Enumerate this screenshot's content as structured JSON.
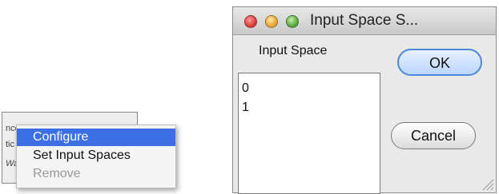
{
  "background_panel": {
    "row1_text": "nce I",
    "row2_text": "tic",
    "row3_text": "Wati"
  },
  "context_menu": {
    "items": [
      {
        "label": "Configure",
        "state": "highlighted"
      },
      {
        "label": "Set Input Spaces",
        "state": "enabled"
      },
      {
        "label": "Remove",
        "state": "disabled"
      }
    ],
    "highlight_color": "#3c6fe4"
  },
  "dialog": {
    "title": "Input Space S...",
    "list_label": "Input Space",
    "list_items": [
      "0",
      "1"
    ],
    "ok_label": "OK",
    "cancel_label": "Cancel"
  }
}
